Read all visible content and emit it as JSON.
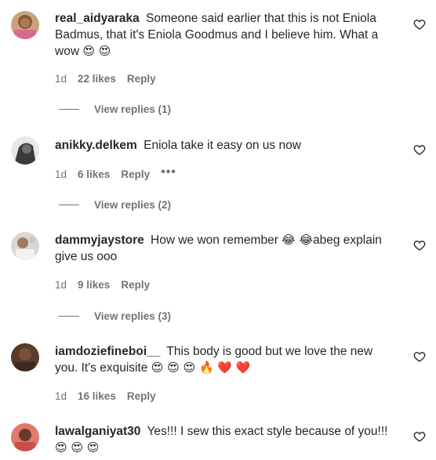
{
  "comments": [
    {
      "username": "real_aidyaraka",
      "text": "Someone said earlier that this is not Eniola Badmus, that it's Eniola Goodmus and I believe him. What a wow",
      "emojis": "😍 😍",
      "time": "1d",
      "likes": "22 likes",
      "reply": "Reply",
      "view_replies": "View replies (1)"
    },
    {
      "username": "anikky.delkem",
      "text": "Eniola take it easy on us now",
      "emojis": "",
      "time": "1d",
      "likes": "6 likes",
      "reply": "Reply",
      "more": "•••",
      "view_replies": "View replies (2)"
    },
    {
      "username": "dammyjaystore",
      "text_before": "How we won remember",
      "emojis": "😂 😂",
      "text_after": "abeg explain give us ooo",
      "time": "1d",
      "likes": "9 likes",
      "reply": "Reply",
      "view_replies": "View replies (3)"
    },
    {
      "username": "iamdoziefineboi__",
      "text": "This body is good but we love the new you. It's exquisite",
      "emojis": "😍 😍 😍 🔥 ❤️ ❤️",
      "time": "1d",
      "likes": "16 likes",
      "reply": "Reply"
    },
    {
      "username": "lawalganiyat30",
      "text": "Yes!!! I sew this exact style because of you!!!",
      "emojis": "😍 😍 😍"
    }
  ],
  "colors": {
    "text": "#262626",
    "secondary": "#737373",
    "heart_icon": "heart-outline"
  }
}
